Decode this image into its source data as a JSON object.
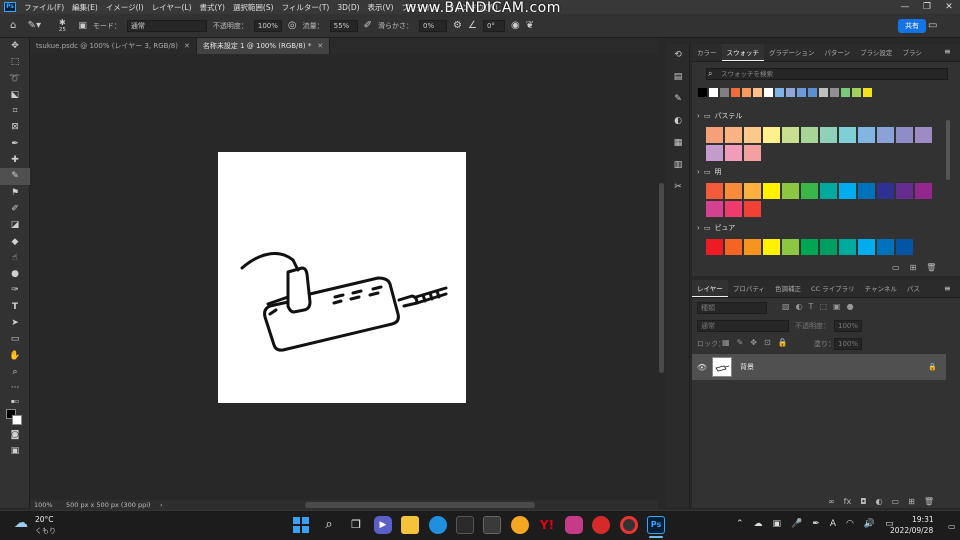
{
  "menubar": {
    "app_badge": "Ps",
    "items": [
      "ファイル(F)",
      "編集(E)",
      "イメージ(I)",
      "レイヤー(L)",
      "書式(Y)",
      "選択範囲(S)",
      "フィルター(T)",
      "3D(D)",
      "表示(V)",
      "プラグイン",
      "ウィンドウ(W)"
    ]
  },
  "watermark": "www.BANDICAM.com",
  "options": {
    "brush_size": "25",
    "mode_label": "モード：",
    "mode_value": "通常",
    "opacity_label": "不透明度：",
    "opacity_value": "100%",
    "flow_label": "流量：",
    "flow_value": "55%",
    "smoothing_label": "滑らかさ：",
    "smoothing_value": "0%",
    "angle_value": "0°",
    "share_label": "共有"
  },
  "tabs": [
    {
      "label": "tsukue.psdc @ 100% (レイヤー 3, RGB/8)",
      "active": false
    },
    {
      "label": "名称未設定 1 @ 100% (RGB/8) *",
      "active": true
    }
  ],
  "status": {
    "zoom": "100%",
    "dims": "500 px x 500 px (300 ppi)"
  },
  "swatch_panel": {
    "tabs": [
      "カラー",
      "スウォッチ",
      "グラデーション",
      "パターン",
      "ブラシ設定",
      "ブラシ"
    ],
    "active_tab": "スウォッチ",
    "search_placeholder": "スウォッチを検索",
    "recent_colors": [
      "#000000",
      "#ffffff",
      "#808080",
      "#f26b3a",
      "#f59a5c",
      "#fbc08f",
      "#ffffff",
      "#7fb2e5",
      "#8fa7d8",
      "#6e98d8",
      "#5a8fd1",
      "#bfbfbf",
      "#909090",
      "#7ec77a",
      "#a3d05a",
      "#f2e21b"
    ],
    "groups": [
      {
        "name": "パステル",
        "colors": [
          "#f6a07a",
          "#fbb383",
          "#fdc88a",
          "#fff08e",
          "#c7df8f",
          "#a7d597",
          "#8fd0b6",
          "#7fcfd6",
          "#82b6e2",
          "#8aa2d7",
          "#8e8dc8",
          "#9e8bc4",
          "#c39ccb",
          "#f29cb9",
          "#f5a0a0"
        ]
      },
      {
        "name": "明",
        "colors": [
          "#f15a3a",
          "#f78b39",
          "#fbb040",
          "#fff200",
          "#8dc63f",
          "#39b54a",
          "#00a99d",
          "#00aeef",
          "#0072bc",
          "#2e3192",
          "#662d91",
          "#92278f",
          "#d4418e",
          "#ee3b6c",
          "#ef4136"
        ]
      },
      {
        "name": "ピュア",
        "colors": [
          "#ed1c24",
          "#f26522",
          "#f7941d",
          "#fff200",
          "#8dc63f",
          "#00a651",
          "#009e60",
          "#00a99d",
          "#00aeef",
          "#0072bc",
          "#0054a6"
        ]
      }
    ]
  },
  "layers_panel": {
    "tabs": [
      "レイヤー",
      "プロパティ",
      "色調補正",
      "CC ライブラリ",
      "チャンネル",
      "パス"
    ],
    "active_tab": "レイヤー",
    "filter_placeholder": "種類",
    "blend_mode": "通常",
    "opacity_label": "不透明度：",
    "opacity_value": "100%",
    "lock_label": "ロック：",
    "fill_label": "塗り：",
    "fill_value": "100%",
    "layer_name": "背景"
  },
  "taskbar": {
    "temperature": "20°C",
    "weather": "くもり",
    "time": "19:31",
    "date": "2022/09/28",
    "ime": "A"
  }
}
